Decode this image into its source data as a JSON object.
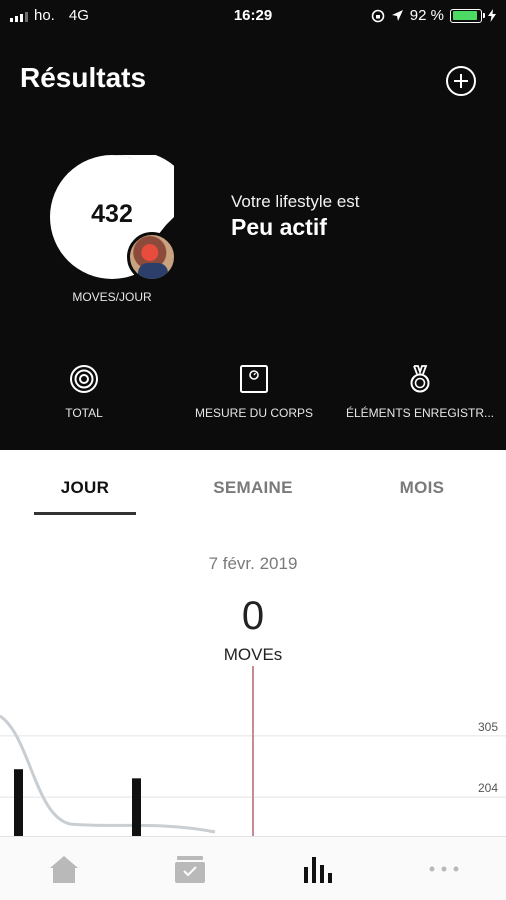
{
  "status_bar": {
    "carrier": "ho.",
    "network": "4G",
    "time": "16:29",
    "battery": "92 %",
    "battery_level": 0.92
  },
  "header": {
    "title": "Résultats"
  },
  "summary": {
    "score": "432",
    "unit_label": "MOVES/JOUR",
    "lifestyle_label": "Votre lifestyle est",
    "lifestyle_value": "Peu actif"
  },
  "shortcuts": [
    {
      "label": "TOTAL",
      "icon": "rings-icon"
    },
    {
      "label": "MESURE DU CORPS",
      "icon": "scale-icon"
    },
    {
      "label": "ÉLÉMENTS ENREGISTR...",
      "icon": "medal-icon"
    }
  ],
  "tabs": [
    {
      "label": "JOUR",
      "active": true
    },
    {
      "label": "SEMAINE",
      "active": false
    },
    {
      "label": "MOIS",
      "active": false
    }
  ],
  "day_view": {
    "date": "7 févr. 2019",
    "value": "0",
    "unit": "MOVEs"
  },
  "chart_data": {
    "type": "bar",
    "y_ticks": [
      "305",
      "204"
    ],
    "bars": [
      {
        "value": 250
      },
      {
        "value": 235
      }
    ],
    "ymin": 140,
    "ymax": 420,
    "marker_color": "#c98b93",
    "bar_color": "#111111",
    "trend_color": "#c9ced3"
  },
  "bottom_nav": [
    {
      "icon": "home-icon"
    },
    {
      "icon": "inbox-icon"
    },
    {
      "icon": "bar-chart-icon",
      "active": true
    },
    {
      "icon": "more-icon"
    }
  ],
  "colors": {
    "header_bg": "#0c0c0c",
    "battery_fill": "#4cd964"
  }
}
